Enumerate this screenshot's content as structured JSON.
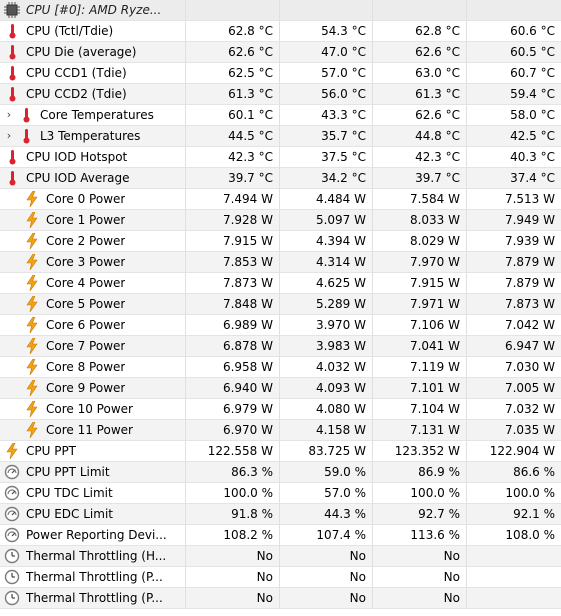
{
  "header": {
    "title": "CPU [#0]: AMD Ryze..."
  },
  "rows": [
    {
      "label": "CPU (Tctl/Tdie)",
      "icon": "thermometer-icon",
      "indent": 0,
      "expander": "",
      "v": [
        "62.8 °C",
        "54.3 °C",
        "62.8 °C",
        "60.6 °C"
      ]
    },
    {
      "label": "CPU Die (average)",
      "icon": "thermometer-icon",
      "indent": 0,
      "expander": "",
      "v": [
        "62.6 °C",
        "47.0 °C",
        "62.6 °C",
        "60.5 °C"
      ]
    },
    {
      "label": "CPU CCD1 (Tdie)",
      "icon": "thermometer-icon",
      "indent": 0,
      "expander": "",
      "v": [
        "62.5 °C",
        "57.0 °C",
        "63.0 °C",
        "60.7 °C"
      ]
    },
    {
      "label": "CPU CCD2 (Tdie)",
      "icon": "thermometer-icon",
      "indent": 0,
      "expander": "",
      "v": [
        "61.3 °C",
        "56.0 °C",
        "61.3 °C",
        "59.4 °C"
      ]
    },
    {
      "label": "Core Temperatures",
      "icon": "thermometer-icon",
      "indent": 1,
      "expander": "›",
      "v": [
        "60.1 °C",
        "43.3 °C",
        "62.6 °C",
        "58.0 °C"
      ]
    },
    {
      "label": "L3 Temperatures",
      "icon": "thermometer-icon",
      "indent": 1,
      "expander": "›",
      "v": [
        "44.5 °C",
        "35.7 °C",
        "44.8 °C",
        "42.5 °C"
      ]
    },
    {
      "label": "CPU IOD Hotspot",
      "icon": "thermometer-icon",
      "indent": 0,
      "expander": "",
      "v": [
        "42.3 °C",
        "37.5 °C",
        "42.3 °C",
        "40.3 °C"
      ]
    },
    {
      "label": "CPU IOD Average",
      "icon": "thermometer-icon",
      "indent": 0,
      "expander": "",
      "v": [
        "39.7 °C",
        "34.2 °C",
        "39.7 °C",
        "37.4 °C"
      ]
    },
    {
      "label": "Core 0 Power",
      "icon": "lightning-icon",
      "indent": 1,
      "expander": "",
      "v": [
        "7.494 W",
        "4.484 W",
        "7.584 W",
        "7.513 W"
      ]
    },
    {
      "label": "Core 1 Power",
      "icon": "lightning-icon",
      "indent": 1,
      "expander": "",
      "v": [
        "7.928 W",
        "5.097 W",
        "8.033 W",
        "7.949 W"
      ]
    },
    {
      "label": "Core 2 Power",
      "icon": "lightning-icon",
      "indent": 1,
      "expander": "",
      "v": [
        "7.915 W",
        "4.394 W",
        "8.029 W",
        "7.939 W"
      ]
    },
    {
      "label": "Core 3 Power",
      "icon": "lightning-icon",
      "indent": 1,
      "expander": "",
      "v": [
        "7.853 W",
        "4.314 W",
        "7.970 W",
        "7.879 W"
      ]
    },
    {
      "label": "Core 4 Power",
      "icon": "lightning-icon",
      "indent": 1,
      "expander": "",
      "v": [
        "7.873 W",
        "4.625 W",
        "7.915 W",
        "7.879 W"
      ]
    },
    {
      "label": "Core 5 Power",
      "icon": "lightning-icon",
      "indent": 1,
      "expander": "",
      "v": [
        "7.848 W",
        "5.289 W",
        "7.971 W",
        "7.873 W"
      ]
    },
    {
      "label": "Core 6 Power",
      "icon": "lightning-icon",
      "indent": 1,
      "expander": "",
      "v": [
        "6.989 W",
        "3.970 W",
        "7.106 W",
        "7.042 W"
      ]
    },
    {
      "label": "Core 7 Power",
      "icon": "lightning-icon",
      "indent": 1,
      "expander": "",
      "v": [
        "6.878 W",
        "3.983 W",
        "7.041 W",
        "6.947 W"
      ]
    },
    {
      "label": "Core 8 Power",
      "icon": "lightning-icon",
      "indent": 1,
      "expander": "",
      "v": [
        "6.958 W",
        "4.032 W",
        "7.119 W",
        "7.030 W"
      ]
    },
    {
      "label": "Core 9 Power",
      "icon": "lightning-icon",
      "indent": 1,
      "expander": "",
      "v": [
        "6.940 W",
        "4.093 W",
        "7.101 W",
        "7.005 W"
      ]
    },
    {
      "label": "Core 10 Power",
      "icon": "lightning-icon",
      "indent": 1,
      "expander": "",
      "v": [
        "6.979 W",
        "4.080 W",
        "7.104 W",
        "7.032 W"
      ]
    },
    {
      "label": "Core 11 Power",
      "icon": "lightning-icon",
      "indent": 1,
      "expander": "",
      "v": [
        "6.970 W",
        "4.158 W",
        "7.131 W",
        "7.035 W"
      ]
    },
    {
      "label": "CPU PPT",
      "icon": "lightning-icon",
      "indent": 0,
      "expander": "",
      "v": [
        "122.558 W",
        "83.725 W",
        "123.352 W",
        "122.904 W"
      ]
    },
    {
      "label": "CPU PPT Limit",
      "icon": "gauge-icon",
      "indent": 0,
      "expander": "",
      "v": [
        "86.3 %",
        "59.0 %",
        "86.9 %",
        "86.6 %"
      ]
    },
    {
      "label": "CPU TDC Limit",
      "icon": "gauge-icon",
      "indent": 0,
      "expander": "",
      "v": [
        "100.0 %",
        "57.0 %",
        "100.0 %",
        "100.0 %"
      ]
    },
    {
      "label": "CPU EDC Limit",
      "icon": "gauge-icon",
      "indent": 0,
      "expander": "",
      "v": [
        "91.8 %",
        "44.3 %",
        "92.7 %",
        "92.1 %"
      ]
    },
    {
      "label": "Power Reporting Devi...",
      "icon": "gauge-icon",
      "indent": 0,
      "expander": "",
      "v": [
        "108.2 %",
        "107.4 %",
        "113.6 %",
        "108.0 %"
      ]
    },
    {
      "label": "Thermal Throttling (H...",
      "icon": "clock-icon",
      "indent": 0,
      "expander": "",
      "v": [
        "No",
        "No",
        "No",
        ""
      ]
    },
    {
      "label": "Thermal Throttling (P...",
      "icon": "clock-icon",
      "indent": 0,
      "expander": "",
      "v": [
        "No",
        "No",
        "No",
        ""
      ]
    },
    {
      "label": "Thermal Throttling (P...",
      "icon": "clock-icon",
      "indent": 0,
      "expander": "",
      "v": [
        "No",
        "No",
        "No",
        ""
      ]
    }
  ],
  "colors": {
    "thermometer": "#d9232d",
    "lightning": "#f3a215",
    "gauge": "#7a7a7a",
    "row_alt": "#f3f3f3",
    "header_bg": "#ececec"
  }
}
